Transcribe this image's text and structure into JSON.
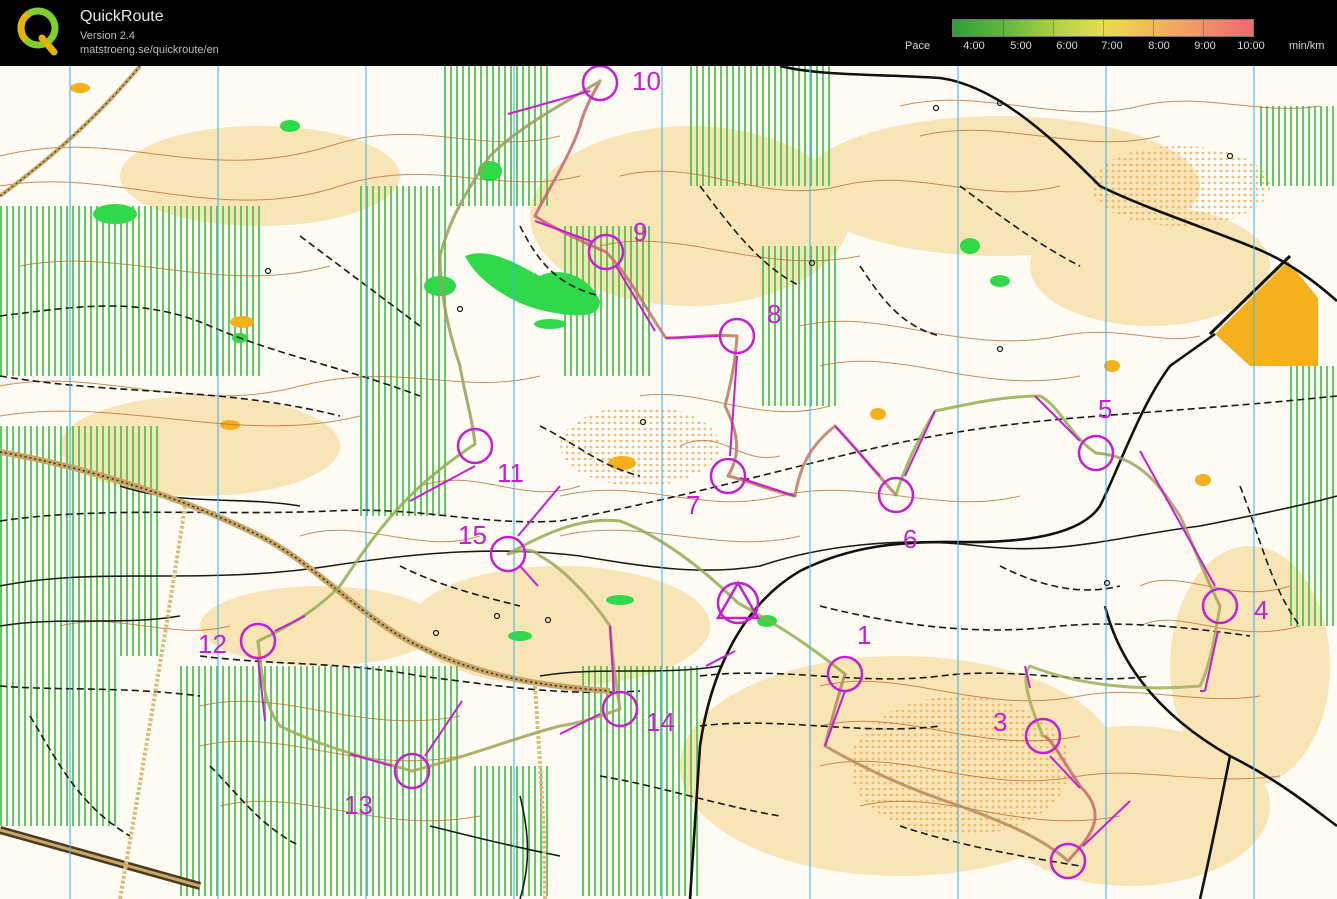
{
  "app": {
    "title": "QuickRoute",
    "version": "Version 2.4",
    "url": "matstroeng.se/quickroute/en"
  },
  "pace_legend": {
    "label": "Pace",
    "ticks": [
      "4:00",
      "5:00",
      "6:00",
      "7:00",
      "8:00",
      "9:00",
      "10:00"
    ],
    "unit": "min/km",
    "colors": [
      "#2f9e3a",
      "#64b83e",
      "#a9cf45",
      "#e6dd4e",
      "#f0c454",
      "#f29a66",
      "#ec6a72"
    ]
  },
  "map": {
    "colors": {
      "paper": "#fdfbf3",
      "contour": "#b86a2a",
      "vegetation_green": "#2fd94a",
      "stripe_green": "#44c24a",
      "open_yellow": "#f7c870",
      "track": "#1a1a1a",
      "road": "#111111",
      "north_line": "#3db7f0",
      "course_purple": "#c41fd0"
    },
    "controls": [
      {
        "label": "1"
      },
      {
        "label": "3"
      },
      {
        "label": "4"
      },
      {
        "label": "5"
      },
      {
        "label": "6"
      },
      {
        "label": "7"
      },
      {
        "label": "8"
      },
      {
        "label": "9"
      },
      {
        "label": "10"
      },
      {
        "label": "11"
      },
      {
        "label": "12"
      },
      {
        "label": "13"
      },
      {
        "label": "14"
      },
      {
        "label": "15"
      }
    ]
  }
}
